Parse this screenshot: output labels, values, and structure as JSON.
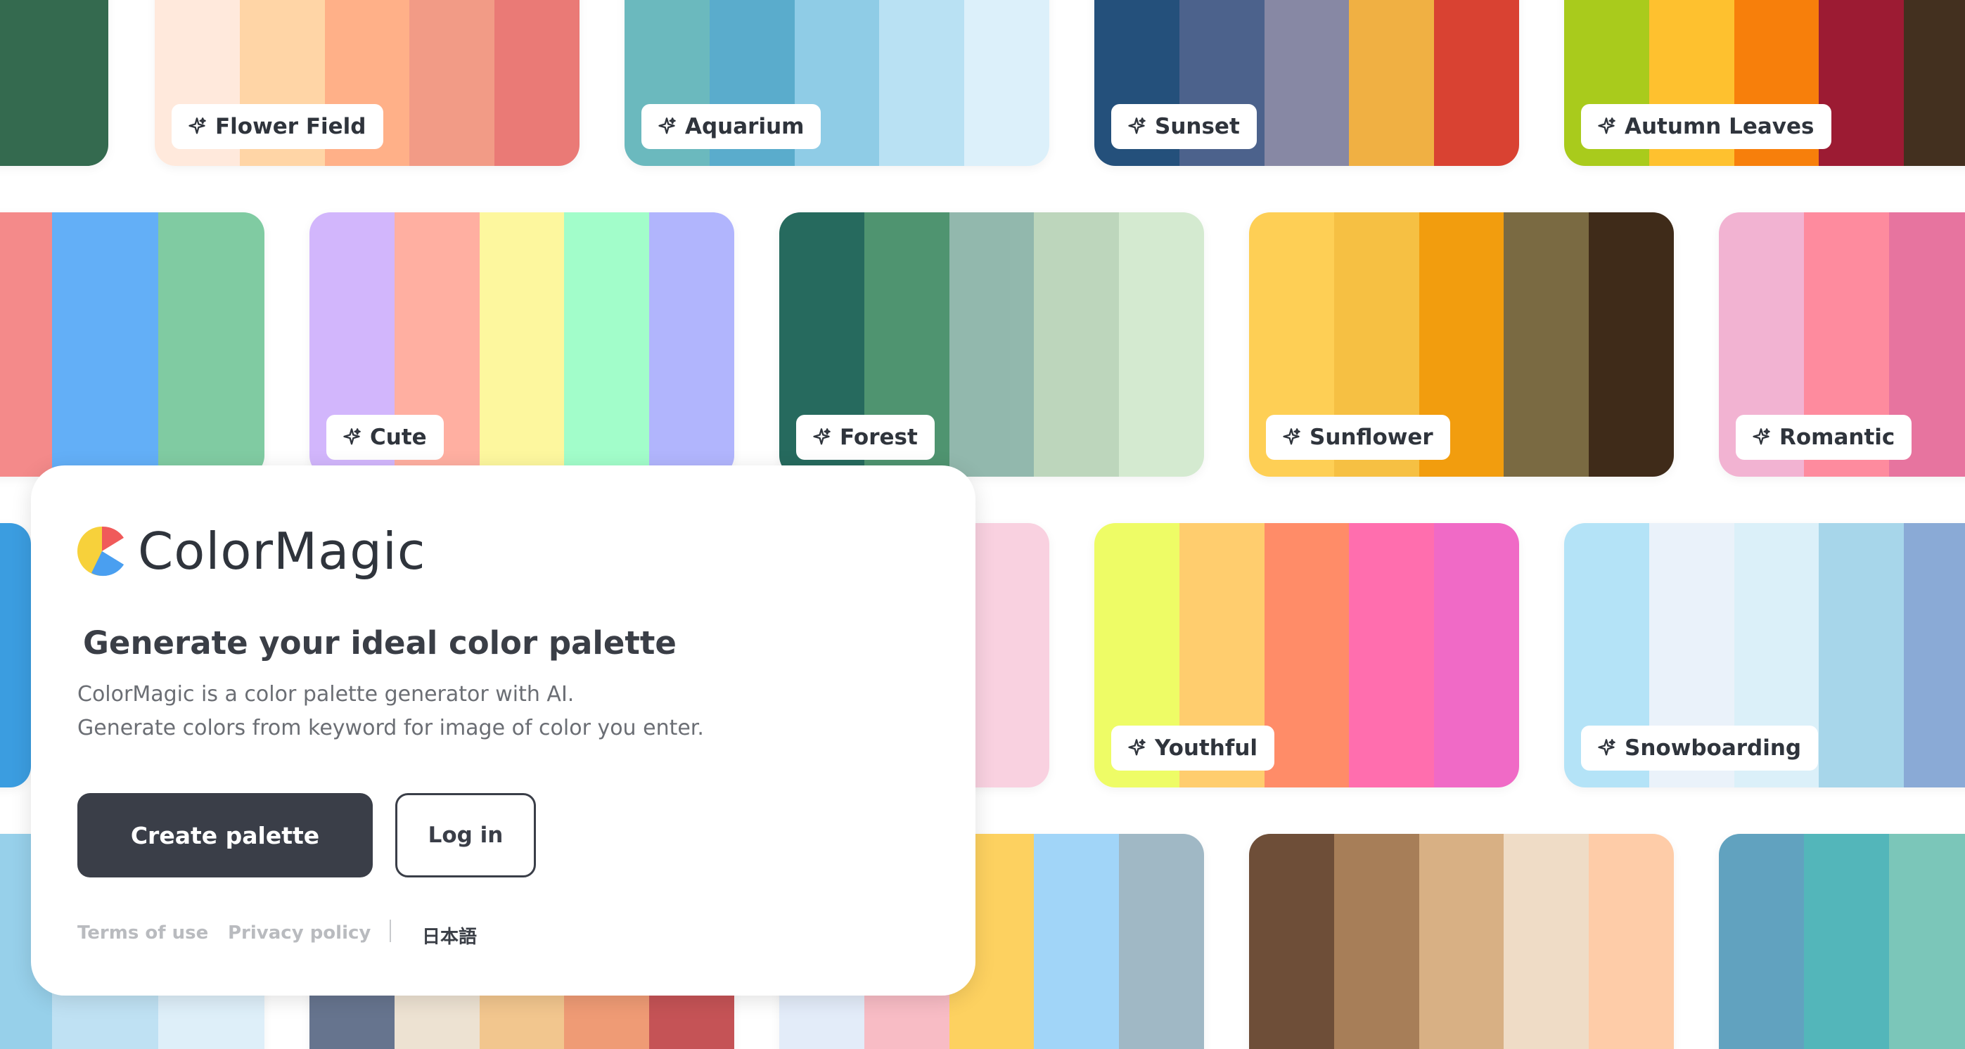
{
  "app": {
    "name": "ColorMagic",
    "headline": "Generate your ideal color palette",
    "description_lines": [
      "ColorMagic is a color palette generator with AI.",
      "Generate colors from keyword for image of color you enter."
    ],
    "create_label": "Create palette",
    "login_label": "Log in",
    "footer": {
      "terms": "Terms of use",
      "privacy": "Privacy policy",
      "separator": "|",
      "language": "日本語"
    },
    "logo_colors": [
      "#f05a5a",
      "#f7d13b",
      "#4a9ff0"
    ]
  },
  "palettes": [
    {
      "name": "",
      "colors": [
        "#5f8f63",
        "#346a4f"
      ]
    },
    {
      "name": "Flower Field",
      "colors": [
        "#ffe9dc",
        "#ffd5a6",
        "#ffb088",
        "#f29b86",
        "#ea7a76"
      ]
    },
    {
      "name": "Aquarium",
      "colors": [
        "#6bb9be",
        "#5aaccc",
        "#8fcce6",
        "#b9e1f3",
        "#dcf0fa"
      ]
    },
    {
      "name": "Sunset",
      "colors": [
        "#24507b",
        "#4c628c",
        "#8788a4",
        "#f0b043",
        "#d94232"
      ]
    },
    {
      "name": "Autumn Leaves",
      "colors": [
        "#a9cb1c",
        "#fec12f",
        "#f77f0b",
        "#9c1b33",
        "#43301f"
      ]
    },
    {
      "name": "",
      "colors": [
        "#f7c54c",
        "#f48a8a",
        "#63aff7",
        "#80cba2"
      ]
    },
    {
      "name": "Cute",
      "colors": [
        "#d2b6fc",
        "#ffafa1",
        "#fdf79e",
        "#a2fdca",
        "#b1b5fd"
      ]
    },
    {
      "name": "Forest",
      "colors": [
        "#266a5e",
        "#4f9470",
        "#92b8ad",
        "#bdd6bc",
        "#d4ead0"
      ]
    },
    {
      "name": "Sunflower",
      "colors": [
        "#fecf55",
        "#f6c043",
        "#f29d0e",
        "#7a6a42",
        "#3f2b19"
      ]
    },
    {
      "name": "Romantic",
      "colors": [
        "#f2b3d2",
        "#fe8b9e",
        "#e7749f",
        "#e7749f",
        "#e7749f"
      ]
    },
    {
      "name": "",
      "colors": [
        "#a9cde2",
        "#3b9de0"
      ]
    },
    {
      "name": "",
      "colors": [
        "#f9d1e0"
      ]
    },
    {
      "name": "Youthful",
      "colors": [
        "#eefc66",
        "#ffcd6e",
        "#ff8c68",
        "#ff6eae",
        "#f06ac6"
      ]
    },
    {
      "name": "Snowboarding",
      "colors": [
        "#b4e3f7",
        "#eaf2fa",
        "#dbf0f9",
        "#a7d6ea",
        "#8aaad6"
      ]
    },
    {
      "name": "",
      "colors": [
        "#62afd6",
        "#97d0ea",
        "#bfe1f3",
        "#deeff9"
      ]
    },
    {
      "name": "",
      "colors": [
        "#66748e",
        "#ede2d2",
        "#f2c68e",
        "#ef9b75",
        "#c55356"
      ]
    },
    {
      "name": "",
      "colors": [
        "#e3ecf9",
        "#f8bcc5",
        "#fdd160",
        "#a1d5f8",
        "#a0b8c5"
      ]
    },
    {
      "name": "",
      "colors": [
        "#6e4e38",
        "#a77e58",
        "#d8b084",
        "#efdcc6",
        "#fecca8"
      ]
    },
    {
      "name": "",
      "colors": [
        "#61a2bf",
        "#53b6ba",
        "#7bc6b9",
        "#7bc6b9",
        "#7bc6b9"
      ]
    }
  ]
}
